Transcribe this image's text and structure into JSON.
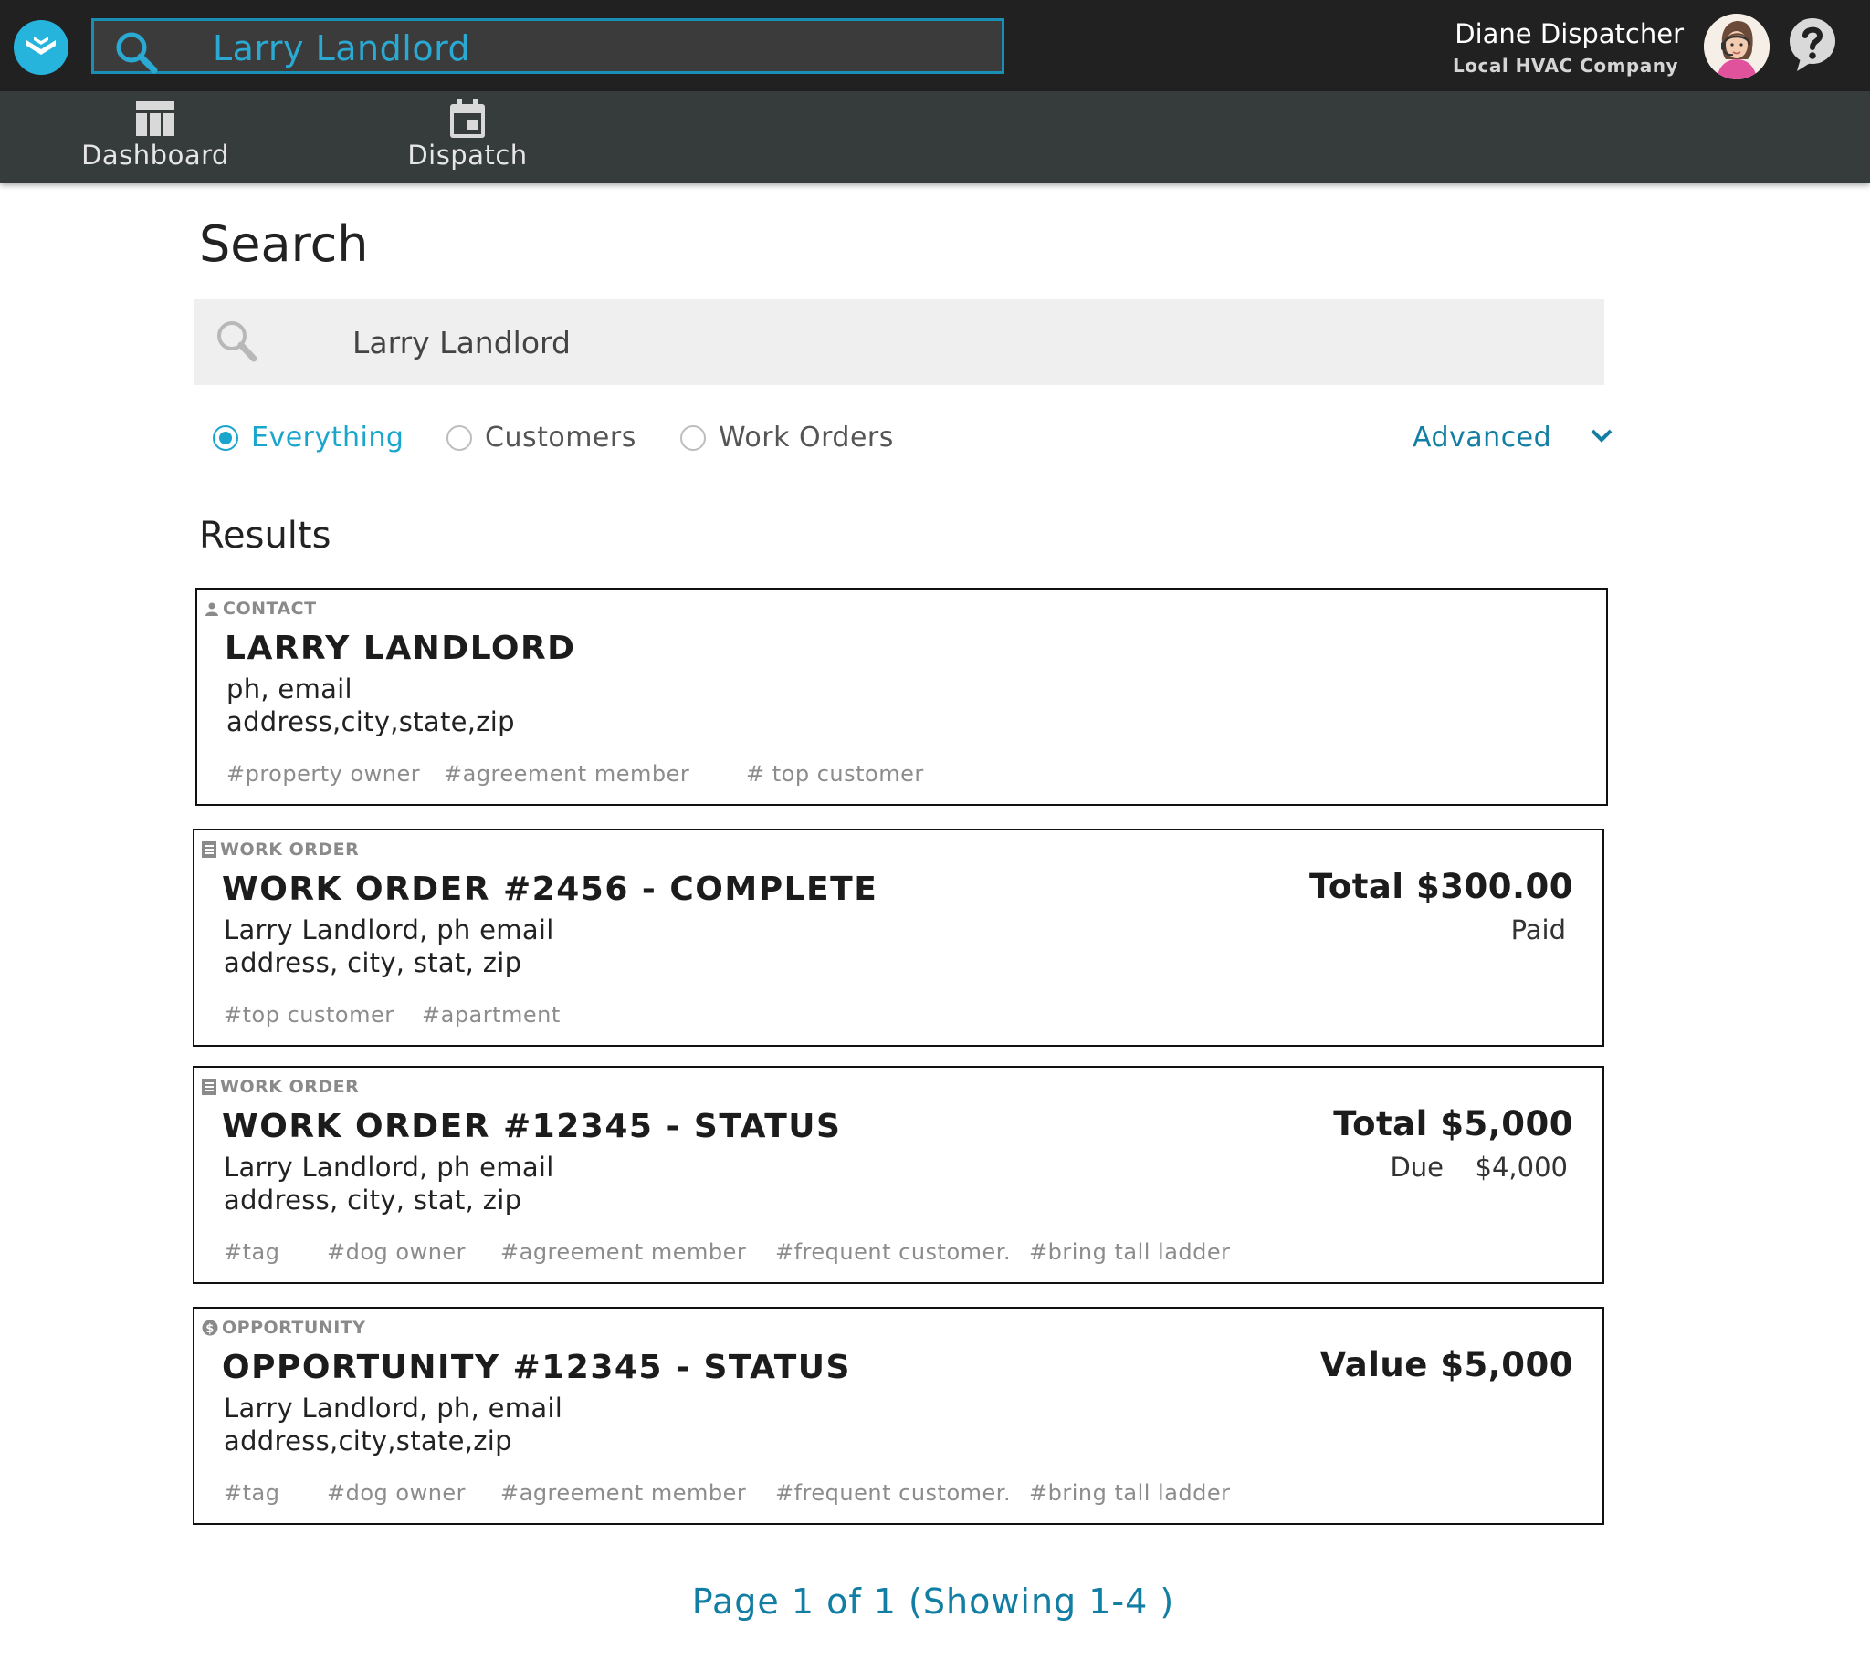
{
  "header": {
    "search_value": "Larry Landlord",
    "user_name": "Diane Dispatcher",
    "company": "Local HVAC Company"
  },
  "nav": {
    "items": [
      {
        "label": "Dashboard",
        "icon": "table-icon"
      },
      {
        "label": "Dispatch",
        "icon": "calendar-icon"
      }
    ]
  },
  "main": {
    "title": "Search",
    "search_value": "Larry Landlord",
    "filters": [
      {
        "label": "Everything",
        "selected": true
      },
      {
        "label": "Customers",
        "selected": false
      },
      {
        "label": "Work Orders",
        "selected": false
      }
    ],
    "advanced_label": "Advanced",
    "results_title": "Results"
  },
  "results": [
    {
      "kind": "CONTACT",
      "kind_icon": "person-icon",
      "title": "LARRY LANDLORD",
      "line1": "ph, email",
      "line2": "address,city,state,zip",
      "tags": [
        "#property owner",
        "#agreement member",
        "# top customer"
      ]
    },
    {
      "kind": "WORK ORDER",
      "kind_icon": "document-icon",
      "title": "WORK ORDER #2456 - COMPLETE",
      "line1": "Larry Landlord, ph email",
      "line2": "address, city, stat, zip",
      "amount": "Total $300.00",
      "status": "Paid",
      "tags": [
        "#top customer",
        "#apartment"
      ]
    },
    {
      "kind": "WORK ORDER",
      "kind_icon": "document-icon",
      "title": "WORK ORDER #12345 - STATUS",
      "line1": "Larry Landlord, ph email",
      "line2": "address, city, stat, zip",
      "amount": "Total $5,000",
      "due_label": "Due",
      "due_value": "$4,000",
      "tags": [
        "#tag",
        "#dog owner",
        "#agreement member",
        "#frequent customer.",
        "#bring tall ladder"
      ]
    },
    {
      "kind": "OPPORTUNITY",
      "kind_icon": "dollar-icon",
      "title": "OPPORTUNITY #12345 - STATUS",
      "line1": "Larry Landlord, ph, email",
      "line2": "address,city,state,zip",
      "amount": "Value $5,000",
      "tags": [
        "#tag",
        "#dog owner",
        "#agreement member",
        "#frequent customer.",
        "#bring tall ladder"
      ]
    }
  ],
  "pagination": "Page 1 of 1 (Showing 1-4 )",
  "colors": {
    "accent": "#1aa5cc",
    "link": "#137ea3",
    "topbar": "#212121",
    "navbar": "#363b3b"
  }
}
